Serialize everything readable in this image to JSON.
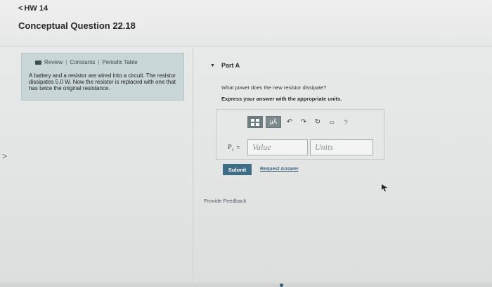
{
  "header": {
    "back_chevron": "<",
    "back_label": "HW 14",
    "page_title": "Conceptual Question 22.18"
  },
  "resources": {
    "icon": "book-icon",
    "review": "Review",
    "separator": "|",
    "constants": "Constants",
    "periodic_table": "Periodic Table"
  },
  "problem": {
    "text": "A battery and a resistor are wired into a circuit. The resistor dissipates 5.0 W. Now the resistor is replaced with one that has twice the original resistance."
  },
  "part": {
    "label": "Part A",
    "question": "What power does the new resistor dissipate?",
    "instruction": "Express your answer with the appropriate units."
  },
  "answer": {
    "toolbar": {
      "templates_icon": "templates-grid-icon",
      "units_button": "μÅ",
      "undo_icon": "undo-icon",
      "redo_icon": "redo-icon",
      "reset_icon": "reset-icon",
      "keyboard_icon": "keyboard-icon",
      "help": "?"
    },
    "variable": "P",
    "subscript": "1",
    "equals": "=",
    "value_placeholder": "Value",
    "units_placeholder": "Units"
  },
  "actions": {
    "submit": "Submit",
    "request_answer": "Request Answer",
    "provide_feedback": "Provide Feedback"
  },
  "colors": {
    "info_panel": "#c9d6d8",
    "submit_button": "#3f6d86",
    "toolbar_button": "#7d8b8e"
  }
}
